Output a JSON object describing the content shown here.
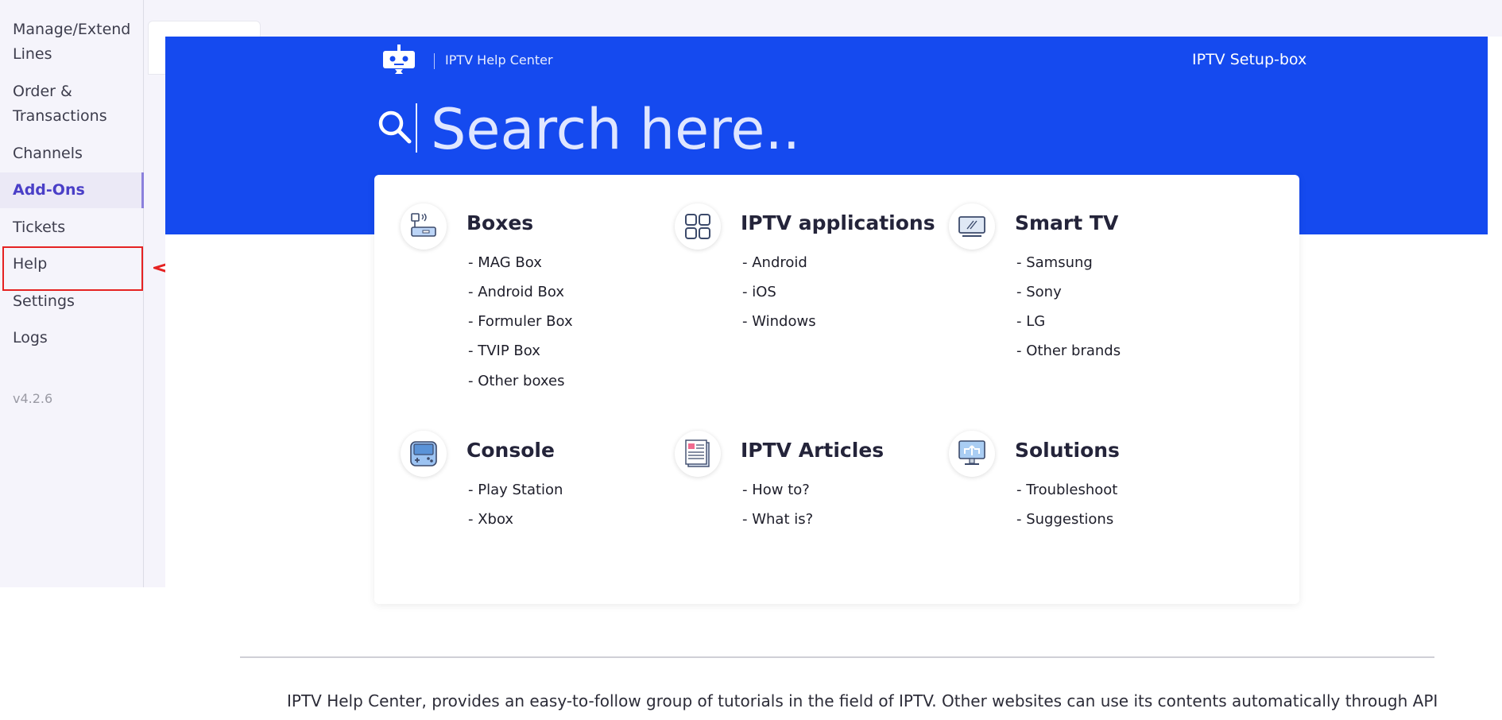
{
  "sidebar": {
    "items": [
      {
        "label_line1": "Manage/Extend",
        "label_line2": "Lines"
      },
      {
        "label_line1": "Order &",
        "label_line2": "Transactions"
      },
      {
        "label": "Channels"
      },
      {
        "label": "Add-Ons"
      },
      {
        "label": "Tickets"
      },
      {
        "label": "Help"
      },
      {
        "label": "Settings"
      },
      {
        "label": "Logs"
      }
    ],
    "active": "Add-Ons",
    "highlighted": "Help",
    "version": "v4.2.6"
  },
  "hero": {
    "brand": "IPTV Help Center",
    "nav_link": "IPTV Setup-box",
    "search_placeholder": "Search here.."
  },
  "categories": [
    {
      "title": "Boxes",
      "icon": "set-top-box-icon",
      "links": [
        "- MAG Box",
        "- Android Box",
        "- Formuler Box",
        "- TVIP Box",
        "- Other boxes"
      ]
    },
    {
      "title": "IPTV applications",
      "icon": "app-grid-icon",
      "links": [
        "- Android",
        "- iOS",
        "- Windows"
      ]
    },
    {
      "title": "Smart TV",
      "icon": "smart-tv-icon",
      "links": [
        "- Samsung",
        "- Sony",
        "- LG",
        "- Other brands"
      ]
    },
    {
      "title": "Console",
      "icon": "game-console-icon",
      "links": [
        "- Play Station",
        "- Xbox"
      ]
    },
    {
      "title": "IPTV Articles",
      "icon": "article-icon",
      "links": [
        "- How to?",
        "- What is?"
      ]
    },
    {
      "title": "Solutions",
      "icon": "solutions-monitor-icon",
      "links": [
        "- Troubleshoot",
        "- Suggestions"
      ]
    }
  ],
  "footer": {
    "text": "IPTV Help Center, provides an easy-to-follow group of tutorials in the field of IPTV. Other websites can use its contents automatically through API"
  },
  "colors": {
    "hero_blue": "#154aef",
    "sidebar_bg": "#f5f4fb",
    "active_text": "#4a3fc7",
    "highlight_red": "#e52222"
  }
}
